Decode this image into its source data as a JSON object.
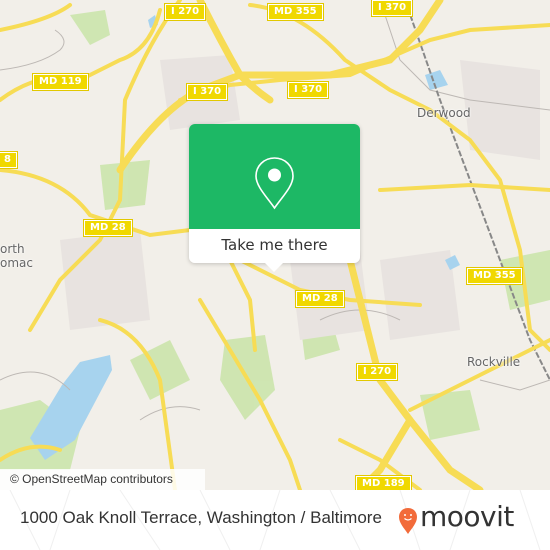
{
  "map": {
    "road_labels": [
      {
        "id": "i270-top",
        "text": "I 270"
      },
      {
        "id": "md355-top",
        "text": "MD 355"
      },
      {
        "id": "i370-top",
        "text": "I 370"
      },
      {
        "id": "md119",
        "text": "MD 119"
      },
      {
        "id": "i370-left",
        "text": "I 370"
      },
      {
        "id": "i370-mid",
        "text": "I 370"
      },
      {
        "id": "md28-left",
        "text": "MD 28"
      },
      {
        "id": "md28-right",
        "text": "MD 28"
      },
      {
        "id": "md355-right",
        "text": "MD 355"
      },
      {
        "id": "i270-bottom",
        "text": "I 270"
      },
      {
        "id": "md189",
        "text": "MD 189"
      },
      {
        "id": "md28-edge",
        "text": "8"
      }
    ],
    "place_labels": [
      {
        "id": "derwood",
        "text": "Derwood"
      },
      {
        "id": "north-potomac-1",
        "text": "orth"
      },
      {
        "id": "north-potomac-2",
        "text": "omac"
      },
      {
        "id": "rockville",
        "text": "Rockville"
      }
    ],
    "attribution": "© OpenStreetMap contributors"
  },
  "popup": {
    "icon": "map-pin-icon",
    "button_label": "Take me there",
    "accent_color": "#1db865"
  },
  "footer": {
    "address": "1000 Oak Knoll Terrace, Washington / Baltimore",
    "brand": "moovit",
    "brand_color": "#f26b3a"
  }
}
